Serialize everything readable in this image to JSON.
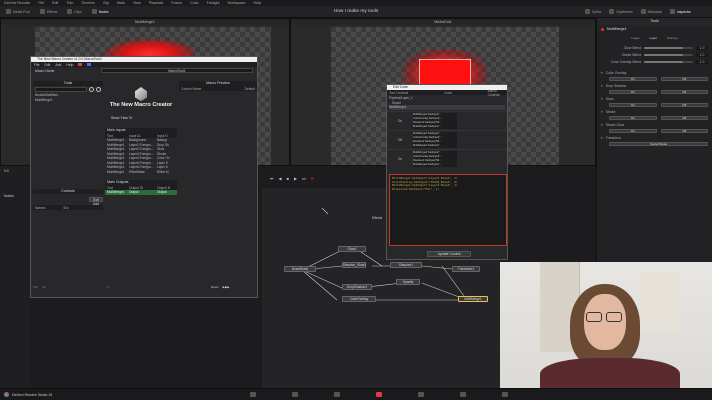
{
  "app": {
    "menu": [
      "DaVinci Resolve",
      "File",
      "Edit",
      "Trim",
      "Timeline",
      "Clip",
      "Mark",
      "View",
      "Playback",
      "Fusion",
      "Color",
      "Fairlight",
      "Workspace",
      "Help"
    ],
    "toolbar_left": [
      "Media Pool",
      "Effects",
      "Clips",
      "Nodes"
    ],
    "project_title": "How I make my tools",
    "toolbar_right": [
      "Spline",
      "Keyframes",
      "Metadata",
      "Inspector"
    ],
    "viewer1_title": "MultiMerge1",
    "viewer2_title": "MediaOut1",
    "footer_label": "DaVinci Resolve Studio 18",
    "footer_pages": [
      "media",
      "cut",
      "edit",
      "fusion",
      "color",
      "fairlight",
      "deliver"
    ],
    "timecode": "0:0",
    "frame_end": "1000"
  },
  "inspector": {
    "header": "Inspector",
    "tab": "Tools",
    "node_name": "MultiMerge1",
    "sub_tabs": [
      "Image",
      "Layer",
      "Settings"
    ],
    "sliders": [
      {
        "label": "Glow Blend",
        "value": "1.0",
        "fraction": 0.8
      },
      {
        "label": "Stroke Blend",
        "value": "1.0",
        "fraction": 0.8
      },
      {
        "label": "Color Overlay Blend",
        "value": "1.0",
        "fraction": 0.8
      }
    ],
    "sections": [
      {
        "label": "Color Overlay",
        "opts": [
          "On",
          "Off"
        ]
      },
      {
        "label": "Drop Shadow",
        "opts": [
          "On",
          "Off"
        ]
      },
      {
        "label": "Glow",
        "opts": [
          "On",
          "Off"
        ]
      },
      {
        "label": "Stroke",
        "opts": [
          "On",
          "Off"
        ]
      },
      {
        "label": "Stroke Glow",
        "opts": [
          "On",
          "Off"
        ]
      },
      {
        "label": "Transform",
        "opts": [
          "Center/Scale"
        ]
      }
    ]
  },
  "macro": {
    "window_title": "The New Macro Creator v1.0.0 MacroTool1",
    "menu": [
      "File",
      "Edit",
      "Add",
      "Help"
    ],
    "macro_name_label": "Macro Name",
    "macro_name_value": "MacroTool1",
    "tools_header": "Tools",
    "tools_items": [
      "Nodes/Modifiers",
      "MultiMerge1"
    ],
    "logo_title": "The New Macro Creator",
    "show_how_to": "Show 'How To'",
    "preview_header": "Macro Preview",
    "preview_cols": [
      "Control Name",
      "Default"
    ],
    "inputs_header": "Main Inputs",
    "inputs_cols": [
      "Tool",
      "Input ID",
      "Input N"
    ],
    "inputs_rows": [
      [
        "MultiMerge1",
        "Background",
        "Backgr"
      ],
      [
        "MultiMerge1",
        "Layer1.Foregro...",
        "Drop Sh"
      ],
      [
        "MultiMerge1",
        "Layer2.Foregro...",
        "Glow"
      ],
      [
        "MultiMerge1",
        "Layer3.Foregro...",
        "Stroke"
      ],
      [
        "MultiMerge1",
        "Layer4.Foregro...",
        "Color Ov"
      ],
      [
        "MultiMerge1",
        "Layer5.Foregro...",
        "Layer 5"
      ],
      [
        "MultiMerge1",
        "Layer6.Foregro...",
        "Layer 6"
      ],
      [
        "MultiMerge1",
        "EffectMask",
        "Effect M"
      ]
    ],
    "outputs_header": "Main Outputs",
    "outputs_cols": [
      "Tool",
      "Output ID",
      "Output N"
    ],
    "outputs_row": [
      "MultiMerge1",
      "Output",
      "Output"
    ],
    "controls_header": "Controls",
    "controls_cols": [
      "Names",
      "IDs"
    ],
    "exit_button": "Exit Add",
    "nav_buttons": [
      "<<<",
      "<<",
      "↑↓",
      "Down",
      "▶▶▶"
    ]
  },
  "edit_code": {
    "title": "Edit Code",
    "cols": [
      "Tool Controls",
      "Code",
      "Macro Controls",
      "Code"
    ],
    "tree": [
      "Pipeline/Layer_1",
      "Glow2",
      "MultiMerge1"
    ],
    "states": [
      "On",
      "Off",
      "On"
    ],
    "code_cells": [
      [
        "MultiMerge1:SetInput(\"...",
        "ColorOverlay:SetInput(\"...",
        "Dissolve1:SetInput(\"Mi...",
        "MultiMerge1:SetInput(\"..."
      ],
      [
        "MultiMerge1:SetInput(\"...",
        "ColorOverlay:SetInput(\"...",
        "Dissolve1:SetInput(\"Mi...",
        "MultiMerge1:SetInput(\"..."
      ],
      [
        "MultiMerge1:SetInput(\"...",
        "ColorOverlay:SetInput(\"...",
        "Dissolve1:SetInput(\"Mi...",
        "MultiMerge1:SetInput(\"..."
      ]
    ],
    "code_lines": [
      "MultiMerge1:SetInput(\"Layer5.Blend\", 1)",
      "ColorOverlay:SetInput(\"TOOLB_Blend\", 0)",
      "MultiMerge1:SetInput(\"Layer4.Blend\", 1)",
      "Dissolve1:SetInput(\"Mix\", 1)"
    ],
    "update_button": "Update Control"
  },
  "nodes": [
    "DrawShield",
    "Glow1",
    "Dissolve_Glow1",
    "Dissolve1",
    "DropShadow1",
    "Opacity",
    "Transform1",
    "ColorOverlay",
    "MultiMerge1",
    "MediaIn1",
    "Fusion"
  ],
  "node_editor_title": "Effects",
  "playback": [
    "⏮",
    "◀",
    "■",
    "▶",
    "⏭",
    "⟳"
  ],
  "colors": {
    "accent_red": "#ff2020",
    "select_green": "#2e6b3a",
    "highlight": "#c0392b"
  }
}
